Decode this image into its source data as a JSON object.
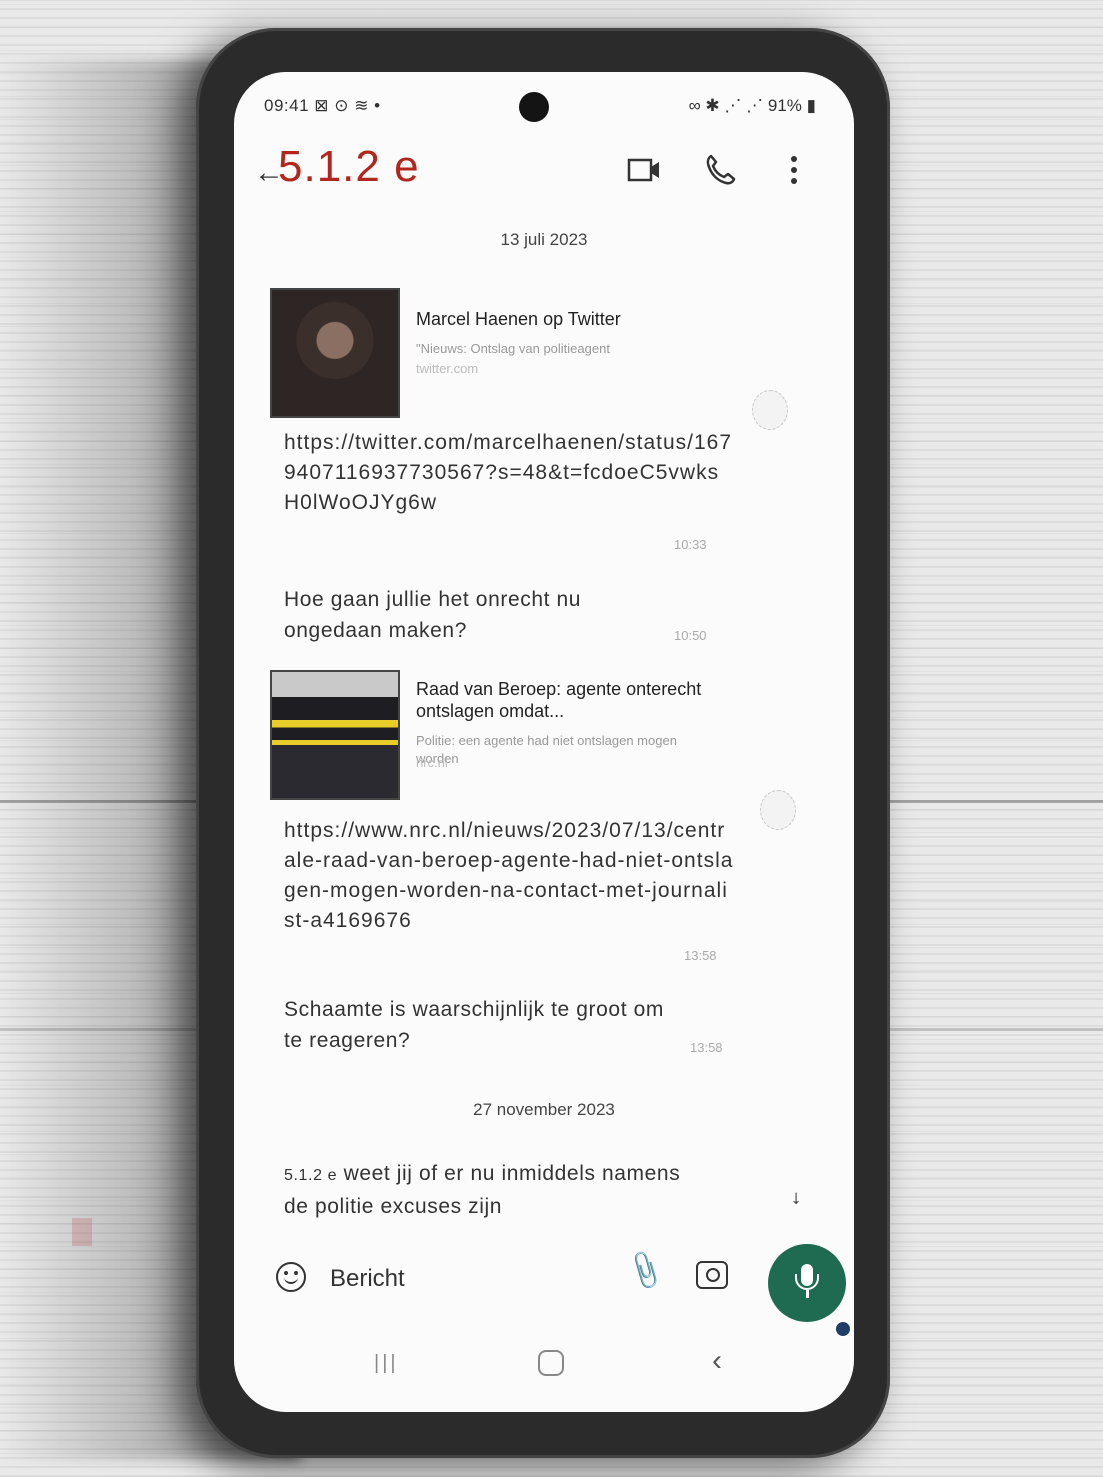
{
  "status_bar": {
    "time": "09:41",
    "left_icons": "⊠ ⊙ ≋ •",
    "right_icons": "∞ ✱ ⋰ ⋰",
    "battery": "91%"
  },
  "header": {
    "contact_name": "5.1.2 e"
  },
  "icons": {
    "back": "arrow-left-icon",
    "video": "video-camera-icon",
    "phone": "phone-icon",
    "more": "more-vert-icon",
    "emoji": "emoji-icon",
    "attach": "paperclip-icon",
    "camera": "camera-icon",
    "mic": "microphone-icon",
    "scroll": "double-chevron-down-icon"
  },
  "conversation": {
    "date_1": "13 juli 2023",
    "card_1": {
      "title": "Marcel Haenen op Twitter",
      "description": "\"Nieuws: Ontslag van politieagent",
      "domain": "twitter.com"
    },
    "link_1": "https://twitter.com/marcelhaenen/status/1679407116937730567?s=48&t=fcdoeC5vwksH0lWoOJYg6w",
    "time_1": "10:33",
    "message_1": "Hoe gaan jullie het onrecht nu ongedaan maken?",
    "time_2": "10:50",
    "card_2": {
      "title": "Raad van Beroep: agente onterecht ontslagen omdat...",
      "description": "Politie: een agente had niet ontslagen mogen worden",
      "domain": "nrc.nl"
    },
    "link_2": "https://www.nrc.nl/nieuws/2023/07/13/centrale-raad-van-beroep-agente-had-niet-ontslagen-mogen-worden-na-contact-met-journalist-a4169676",
    "time_3": "13:58",
    "message_2": "Schaamte is waarschijnlijk te groot om te reageren?",
    "time_4": "13:58",
    "date_2": "27 november 2023",
    "message_3_prefix": "5.1.2 e",
    "message_3": "weet jij of er nu inmiddels namens de politie excuses zijn"
  },
  "composer": {
    "placeholder": "Bericht"
  },
  "colors": {
    "title_red": "#b3261e",
    "mic_green": "#1f6b52",
    "screen_bg": "#fbfbfb"
  }
}
